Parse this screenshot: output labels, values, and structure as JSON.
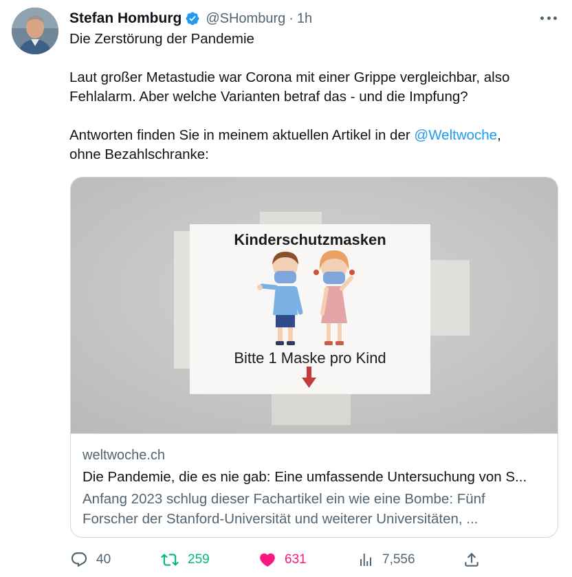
{
  "author": {
    "name": "Stefan Homburg",
    "handle": "@SHomburg",
    "separator": "·",
    "time": "1h"
  },
  "tweet": {
    "line1": "Die Zerstörung der Pandemie",
    "line2": "Laut großer Metastudie war Corona mit einer Grippe vergleichbar, also",
    "line3": "Fehlalarm. Aber welche Varianten betraf das - und die Impfung?",
    "line4_prefix": "Antworten finden Sie in meinem aktuellen Artikel in der ",
    "line4_mention": "@Weltwoche",
    "line4_suffix": ",",
    "line5": "ohne Bezahlschranke:"
  },
  "card": {
    "sign_heading": "Kinderschutzmasken",
    "sign_caption": "Bitte 1 Maske pro Kind",
    "domain": "weltwoche.ch",
    "title": "Die Pandemie, die es nie gab: Eine umfassende Untersuchung von S...",
    "desc_line1": "Anfang 2023 schlug dieser Fachartikel ein wie eine Bombe: Fünf",
    "desc_line2": "Forscher der Stanford-Universität und weiterer Universitäten, ..."
  },
  "actions": {
    "replies": "40",
    "retweets": "259",
    "likes": "631",
    "views": "7,556"
  },
  "colors": {
    "accent": "#1d9bf0",
    "retweet": "#00ba7c",
    "like": "#f91880",
    "secondary_text": "#536471"
  },
  "icons": [
    "verified-badge-icon",
    "more-icon",
    "reply-icon",
    "retweet-icon",
    "heart-icon",
    "views-icon",
    "share-icon"
  ]
}
